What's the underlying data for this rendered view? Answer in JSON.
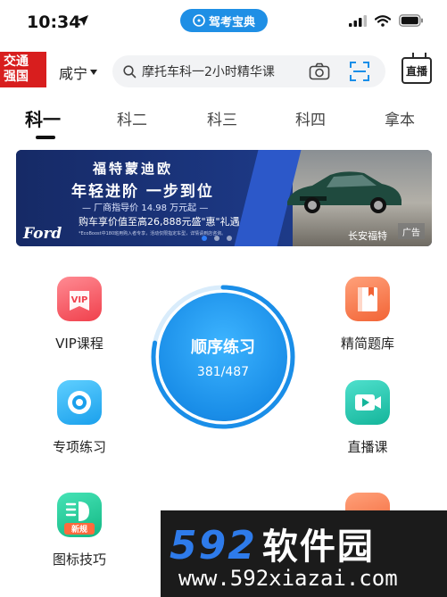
{
  "status_bar": {
    "time": "10:34",
    "app_name": "驾考宝典"
  },
  "header": {
    "logo_line1": "交通",
    "logo_line2": "强国",
    "city": "咸宁",
    "search_placeholder": "摩托车科一2小时精华课",
    "live_label": "直播"
  },
  "tabs": [
    {
      "label": "科一",
      "active": true
    },
    {
      "label": "科二",
      "active": false
    },
    {
      "label": "科三",
      "active": false
    },
    {
      "label": "科四",
      "active": false
    },
    {
      "label": "拿本",
      "active": false
    }
  ],
  "banner": {
    "line1": "福特蒙迪欧",
    "line2": "年轻进阶 一步到位",
    "line3": "— 厂商指导价 14.98 万元起 —",
    "line4": "购车享价值至高26,888元盛\"惠\"礼遇",
    "line5": "*EcoBoost中180班用购入者专享，活动仅限指定车型，详情请到店咨询。",
    "ford_logo": "Ford",
    "brand_label": "长安福特",
    "ad_tag": "广告",
    "slides": 3,
    "active_slide": 1
  },
  "features": {
    "vip": "VIP课程",
    "questions": "精简题库",
    "special": "专项练习",
    "live": "直播课",
    "signs": "图标技巧",
    "signs_badge": "新规"
  },
  "practice": {
    "title": "顺序练习",
    "progress": "381/487",
    "done": 381,
    "total": 487
  },
  "watermark": {
    "brand_digits": "592",
    "brand_text": "软件园",
    "url": "www.592xiazai.com"
  },
  "colors": {
    "accent": "#1a8ee8",
    "watermark_bg": "#1b1b1b"
  }
}
